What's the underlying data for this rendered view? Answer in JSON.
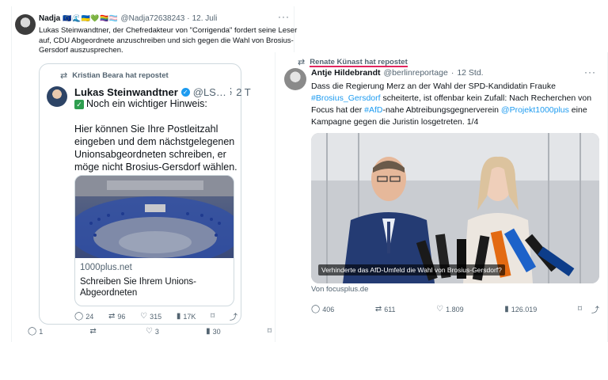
{
  "main_post": {
    "author_name": "Nadja",
    "author_emoji": "🇪🇺🌊🇺🇦💚🏳️‍🌈🏳️‍⚧️",
    "handle": "@Nadja72638243",
    "separator": "·",
    "date": "12. Juli",
    "more": "···",
    "text": "Lukas Steinwandtner, der Chefredakteur von \"Corrigenda\" fordert seine Leser auf, CDU Abgeordnete anzuschreiben und sich gegen die Wahl von Brosius-Gersdorf auszusprechen.",
    "actions": {
      "replies": "1",
      "reposts": "",
      "likes": "3",
      "views": "30"
    }
  },
  "quoted": {
    "repost_label": "Kristian Beara hat repostet",
    "author_name": "Lukas Steinwandtner",
    "handle": "@LS…",
    "separator": "·",
    "time": "2 T",
    "more": "⋮",
    "line1": "Noch ein wichtiger Hinweis:",
    "line2": "Hier können Sie Ihre Postleitzahl eingeben und dem nächstgelegenen Unionsabgeordneten schreiben, er möge nicht Brosius-Gersdorf wählen.",
    "link_domain": "1000plus.net",
    "link_title": "Schreiben Sie Ihrem Unions-Abgeordneten",
    "actions": {
      "replies": "24",
      "reposts": "96",
      "likes": "315",
      "views": "17K"
    }
  },
  "right_post": {
    "repost_label": "Renate Künast hat repostet",
    "author_name": "Antje Hildebrandt",
    "handle": "@berlinreportage",
    "separator": "·",
    "time": "12 Std.",
    "more": "···",
    "text_a": "Dass die Regierung Merz an der Wahl der SPD-Kandidatin Frauke ",
    "tag1": "#Brosius_Gersdorf",
    "text_b": " scheiterte, ist offenbar kein Zufall: Nach Recherchen von Focus hat der ",
    "tag2": "#AfD",
    "text_c": "-nahe Abtreibungsgegnerverein ",
    "tag3": "@Projekt1000plus",
    "text_d": " eine Kampagne gegen die Juristin losgetreten. 1/4",
    "image_caption": "Verhinderte das AfD-Umfeld die Wahl von Brosius-Gersdorf?",
    "source": "Von focusplus.de",
    "actions": {
      "replies": "406",
      "reposts": "611",
      "likes": "1.809",
      "views": "126.019"
    }
  },
  "icons": {
    "reply": "reply-icon",
    "repost": "repost-icon",
    "like": "heart-icon",
    "views": "views-icon",
    "bookmark": "bookmark-icon",
    "share": "share-icon"
  },
  "colors": {
    "link": "#1d9bf0",
    "muted": "#536471",
    "highlight_underline": "#e0245e"
  }
}
